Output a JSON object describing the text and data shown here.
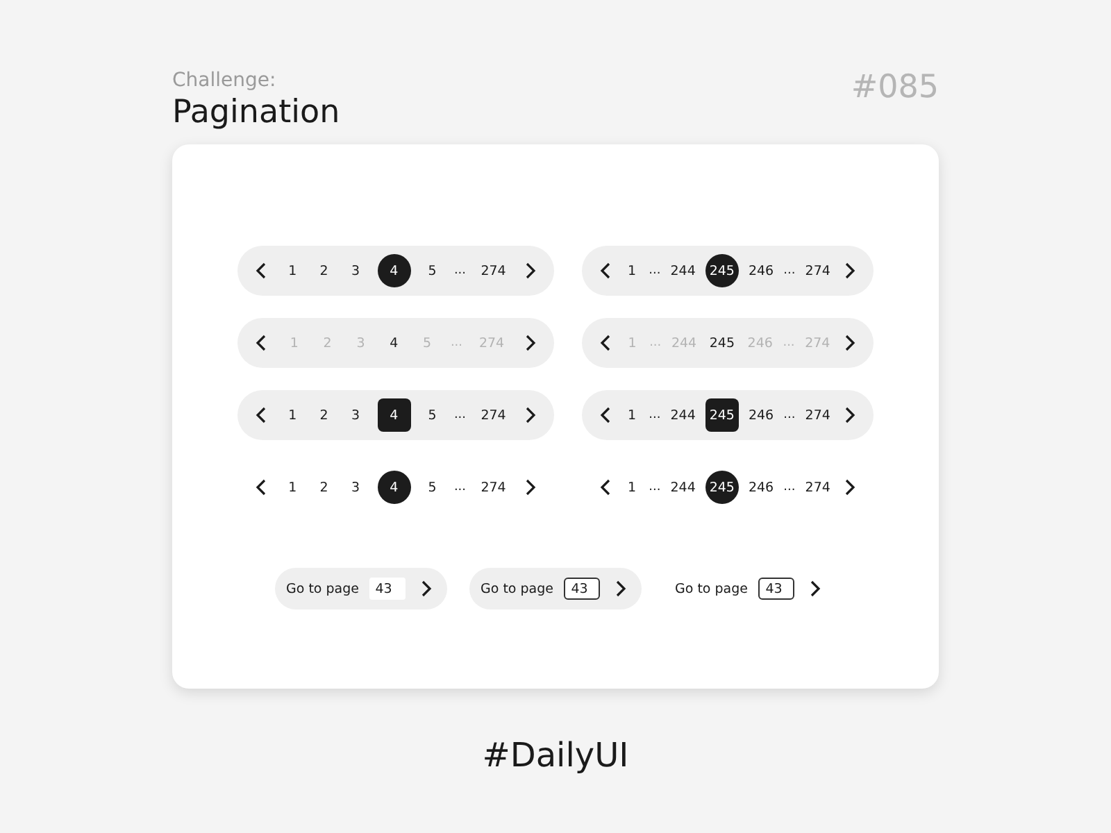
{
  "header": {
    "eyebrow": "Challenge:",
    "title": "Pagination",
    "number": "#085"
  },
  "paginators": [
    {
      "kind": "pill-circle",
      "items": [
        {
          "kind": "page",
          "label": "1",
          "selected": false
        },
        {
          "kind": "page",
          "label": "2",
          "selected": false
        },
        {
          "kind": "page",
          "label": "3",
          "selected": false
        },
        {
          "kind": "page",
          "label": "4",
          "selected": true
        },
        {
          "kind": "page",
          "label": "5",
          "selected": false
        },
        {
          "kind": "ellipsis",
          "label": "..."
        },
        {
          "kind": "page",
          "label": "274",
          "selected": false
        }
      ]
    },
    {
      "kind": "pill-circle",
      "items": [
        {
          "kind": "page",
          "label": "1",
          "selected": false
        },
        {
          "kind": "ellipsis",
          "label": "..."
        },
        {
          "kind": "page",
          "label": "244",
          "selected": false
        },
        {
          "kind": "page",
          "label": "245",
          "selected": true
        },
        {
          "kind": "page",
          "label": "246",
          "selected": false
        },
        {
          "kind": "ellipsis",
          "label": "..."
        },
        {
          "kind": "page",
          "label": "274",
          "selected": false
        }
      ]
    },
    {
      "kind": "pill-text",
      "items": [
        {
          "kind": "page",
          "label": "1",
          "selected": false
        },
        {
          "kind": "page",
          "label": "2",
          "selected": false
        },
        {
          "kind": "page",
          "label": "3",
          "selected": false
        },
        {
          "kind": "page",
          "label": "4",
          "selected": true
        },
        {
          "kind": "page",
          "label": "5",
          "selected": false
        },
        {
          "kind": "ellipsis",
          "label": "..."
        },
        {
          "kind": "page",
          "label": "274",
          "selected": false
        }
      ]
    },
    {
      "kind": "pill-text",
      "items": [
        {
          "kind": "page",
          "label": "1",
          "selected": false
        },
        {
          "kind": "ellipsis",
          "label": "..."
        },
        {
          "kind": "page",
          "label": "244",
          "selected": false
        },
        {
          "kind": "page",
          "label": "245",
          "selected": true
        },
        {
          "kind": "page",
          "label": "246",
          "selected": false
        },
        {
          "kind": "ellipsis",
          "label": "..."
        },
        {
          "kind": "page",
          "label": "274",
          "selected": false
        }
      ]
    },
    {
      "kind": "pill-square",
      "items": [
        {
          "kind": "page",
          "label": "1",
          "selected": false
        },
        {
          "kind": "page",
          "label": "2",
          "selected": false
        },
        {
          "kind": "page",
          "label": "3",
          "selected": false
        },
        {
          "kind": "page",
          "label": "4",
          "selected": true
        },
        {
          "kind": "page",
          "label": "5",
          "selected": false
        },
        {
          "kind": "ellipsis",
          "label": "..."
        },
        {
          "kind": "page",
          "label": "274",
          "selected": false
        }
      ]
    },
    {
      "kind": "pill-square",
      "items": [
        {
          "kind": "page",
          "label": "1",
          "selected": false
        },
        {
          "kind": "ellipsis",
          "label": "..."
        },
        {
          "kind": "page",
          "label": "244",
          "selected": false
        },
        {
          "kind": "page",
          "label": "245",
          "selected": true
        },
        {
          "kind": "page",
          "label": "246",
          "selected": false
        },
        {
          "kind": "ellipsis",
          "label": "..."
        },
        {
          "kind": "page",
          "label": "274",
          "selected": false
        }
      ]
    },
    {
      "kind": "plain-circle",
      "items": [
        {
          "kind": "page",
          "label": "1",
          "selected": false
        },
        {
          "kind": "page",
          "label": "2",
          "selected": false
        },
        {
          "kind": "page",
          "label": "3",
          "selected": false
        },
        {
          "kind": "page",
          "label": "4",
          "selected": true
        },
        {
          "kind": "page",
          "label": "5",
          "selected": false
        },
        {
          "kind": "ellipsis",
          "label": "..."
        },
        {
          "kind": "page",
          "label": "274",
          "selected": false
        }
      ]
    },
    {
      "kind": "plain-circle",
      "items": [
        {
          "kind": "page",
          "label": "1",
          "selected": false
        },
        {
          "kind": "ellipsis",
          "label": "..."
        },
        {
          "kind": "page",
          "label": "244",
          "selected": false
        },
        {
          "kind": "page",
          "label": "245",
          "selected": true
        },
        {
          "kind": "page",
          "label": "246",
          "selected": false
        },
        {
          "kind": "ellipsis",
          "label": "..."
        },
        {
          "kind": "page",
          "label": "274",
          "selected": false
        }
      ]
    }
  ],
  "goto": [
    {
      "kind": "pill-flat",
      "label": "Go to page",
      "value": "43"
    },
    {
      "kind": "pill-outlined",
      "label": "Go to page",
      "value": "43"
    },
    {
      "kind": "plain-outlined",
      "label": "Go to page",
      "value": "43"
    }
  ],
  "footer": "#DailyUI"
}
